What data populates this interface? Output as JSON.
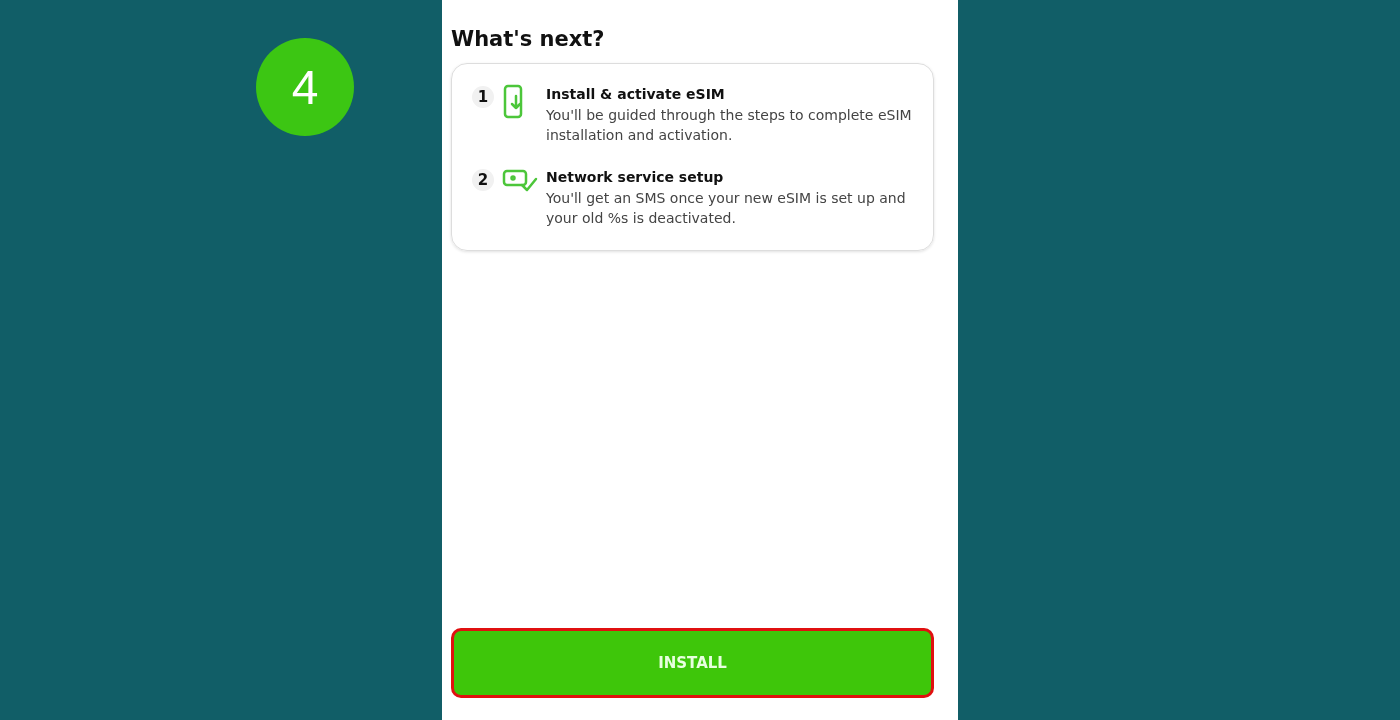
{
  "step_badge": "4",
  "screen": {
    "title": "What's next?",
    "steps": [
      {
        "number": "1",
        "kind": "phone",
        "title": "Install & activate eSIM",
        "description": "You'll be guided through the steps to complete eSIM installation and activation."
      },
      {
        "number": "2",
        "kind": "message",
        "title": "Network service setup",
        "description": "You'll get an SMS once your new eSIM is set up and your old %s is deactivated."
      }
    ],
    "button": {
      "label": "INSTALL",
      "highlighted": true
    }
  }
}
